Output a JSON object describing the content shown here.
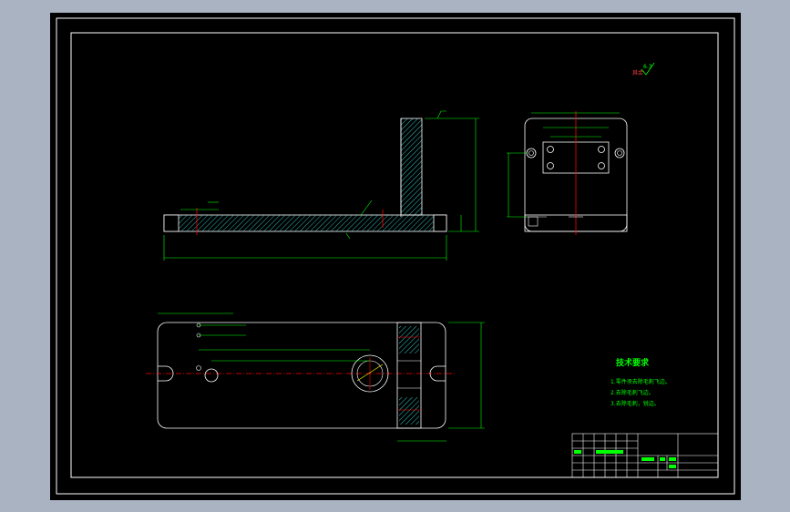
{
  "colors": {
    "background": "#a9b3c1",
    "sheet": "#000000",
    "outline": "#ffffff",
    "dimension": "#00ff00",
    "centerline": "#ff0000",
    "hatch": "#35c8c8",
    "title_block": "#00ff00"
  },
  "notes": {
    "heading": "技术要求",
    "items": [
      "1.零件须去除毛刺飞边。",
      "2.去除毛刺飞边。",
      "3.去除毛刺，锐边。"
    ]
  },
  "surface_finish": {
    "symbol": "其余",
    "value": "6.3"
  }
}
